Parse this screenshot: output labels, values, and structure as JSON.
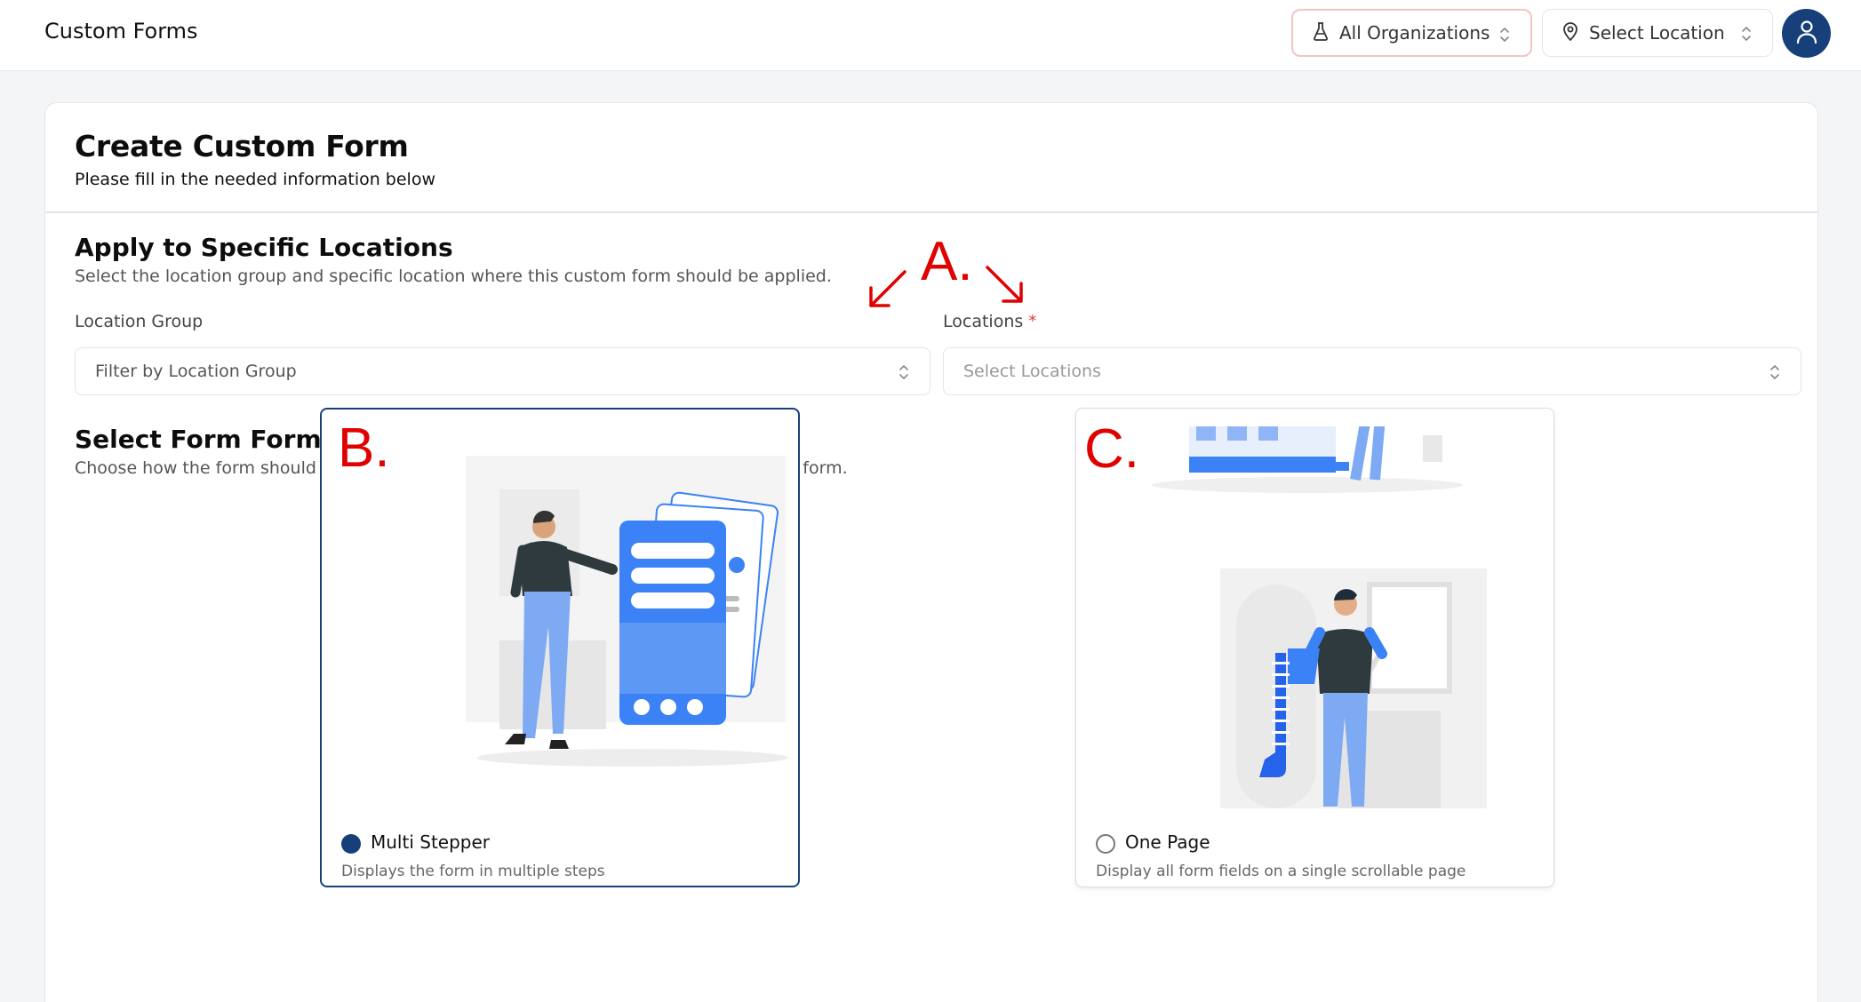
{
  "header": {
    "app_title": "Custom Forms",
    "org_select": {
      "icon": "flask-icon",
      "label": "All Organizations"
    },
    "location_select": {
      "icon": "map-pin-icon",
      "label": "Select Location"
    },
    "avatar_icon": "user-icon"
  },
  "form": {
    "title": "Create Custom Form",
    "subtitle": "Please fill in the needed information below",
    "locations_section": {
      "title": "Apply to Specific Locations",
      "description": "Select the location group and specific location where this custom form should be applied.",
      "location_group": {
        "label": "Location Group",
        "placeholder": "Filter by Location Group"
      },
      "locations": {
        "label": "Locations",
        "required_mark": "*",
        "placeholder": "Select Locations"
      }
    },
    "format_section": {
      "title": "Select Form Format",
      "description": "Choose how the form should be displayed: as a step-by-step form or as a single-page form.",
      "options": [
        {
          "title": "Multi Stepper",
          "description": "Displays the form in multiple steps",
          "selected": true
        },
        {
          "title": "One Page",
          "description": "Display all form fields on a single scrollable page",
          "selected": false
        }
      ]
    }
  },
  "annotations": {
    "a": "A.",
    "b": "B.",
    "c": "C."
  },
  "colors": {
    "primary": "#17407a",
    "accent_blue": "#3b82f6",
    "annotation_red": "#e10000",
    "required_red": "#d83b3b"
  }
}
